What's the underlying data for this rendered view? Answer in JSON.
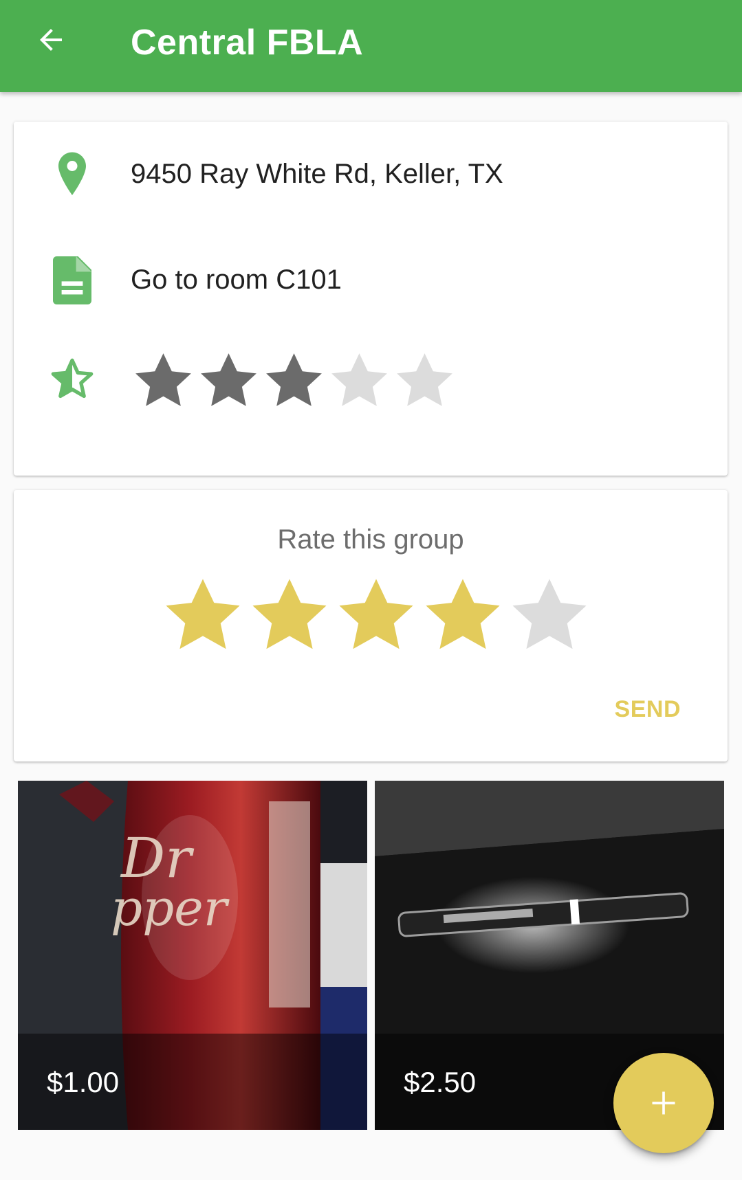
{
  "appbar": {
    "title": "Central FBLA",
    "back_icon": "arrow-back-icon",
    "color": "#4caf50"
  },
  "info": {
    "address": "9450 Ray White Rd, Keller, TX",
    "address_icon": "location-pin-icon",
    "note": "Go to room C101",
    "note_icon": "document-icon",
    "rating_icon": "half-star-icon",
    "rating": 3,
    "rating_max": 5
  },
  "rate": {
    "title": "Rate this group",
    "selected": 4,
    "max": 5,
    "send_label": "SEND",
    "accent": "#e3cb5b"
  },
  "items": [
    {
      "price": "$1.00"
    },
    {
      "price": "$2.50"
    }
  ],
  "fab": {
    "icon": "plus-icon"
  }
}
